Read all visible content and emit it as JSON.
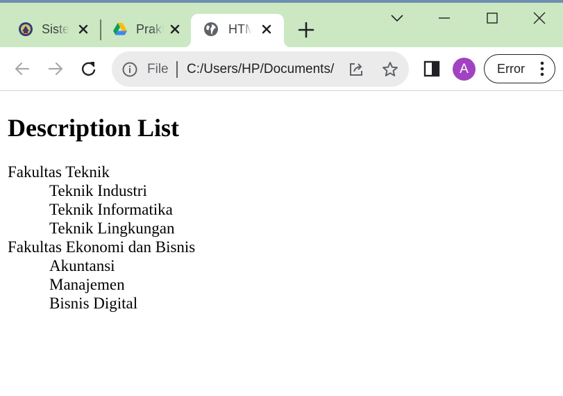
{
  "browser": {
    "tabs": [
      {
        "title": "Sistem",
        "favicon": "university-crest-icon",
        "active": false
      },
      {
        "title": "Praktikum",
        "favicon": "google-drive-icon",
        "active": false
      },
      {
        "title": "HTML",
        "favicon": "globe-icon",
        "active": true
      }
    ],
    "address_bar": {
      "scheme_label": "File",
      "url": "C:/Users/HP/Documents/"
    },
    "profile_initial": "A",
    "error_label": "Error",
    "colors": {
      "tabstrip": "#cbe8c2",
      "avatar": "#a142c2",
      "omnibox": "#ebebeb"
    }
  },
  "page": {
    "heading": "Description List",
    "groups": [
      {
        "term": "Fakultas Teknik",
        "items": [
          "Teknik Industri",
          "Teknik Informatika",
          "Teknik Lingkungan"
        ]
      },
      {
        "term": "Fakultas Ekonomi dan Bisnis",
        "items": [
          "Akuntansi",
          "Manajemen",
          "Bisnis Digital"
        ]
      }
    ]
  }
}
